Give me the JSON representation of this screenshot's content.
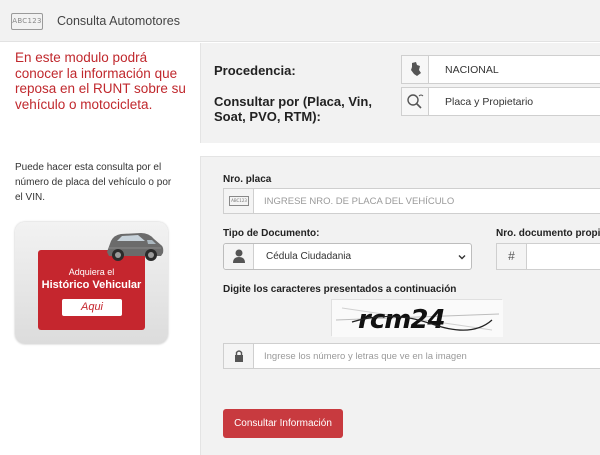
{
  "header": {
    "icon_text": "ABC123",
    "title": "Consulta Automotores"
  },
  "intro": {
    "text": "En este modulo podrá conocer la información que reposa en el RUNT sobre su vehículo o motocicleta.",
    "color": "#c0282d"
  },
  "helper": {
    "text": "Puede hacer esta consulta por el número de placa del vehículo o por el VIN."
  },
  "promo": {
    "line1": "Adquiera el",
    "line2": "Histórico Vehicular",
    "button": "Aqui",
    "color": "#c5262e"
  },
  "query": {
    "procedencia_label": "Procedencia:",
    "procedencia_value": "NACIONAL",
    "procedencia_icon": "colombia-map-icon",
    "consultar_label": "Consultar por (Placa, Vin, Soat, PVO, RTM):",
    "consultar_value": "Placa y Propietario",
    "consultar_icon": "search-icon"
  },
  "form": {
    "placa_label": "Nro. placa",
    "placa_icon_text": "ABC123",
    "placa_placeholder": "INGRESE NRO. DE PLACA DEL VEHÍCULO",
    "tipo_doc_label": "Tipo de Documento:",
    "tipo_doc_value": "Cédula Ciudadania",
    "tipo_doc_icon": "user-icon",
    "nro_doc_label": "Nro. documento propi",
    "nro_doc_icon_text": "#",
    "captcha_label": "Digite los caracteres presentados a continuación",
    "captcha_text": "rcm24",
    "captcha_placeholder": "Ingrese los número y letras que ve en la imagen",
    "captcha_icon": "lock-icon",
    "submit_label": "Consultar Información",
    "submit_color": "#c83a3f"
  }
}
